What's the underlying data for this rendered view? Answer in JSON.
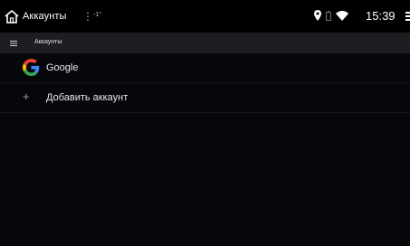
{
  "status_bar": {
    "title": "Аккаунты",
    "more_glyph": "⋮",
    "temperature": "-1°",
    "time": "15:39",
    "icons": [
      "location-pin-icon",
      "battery-icon",
      "wifi-icon",
      "usb-icon"
    ],
    "home_icon": "home-icon"
  },
  "app_bar": {
    "menu_icon": "hamburger-menu-icon",
    "title": "Аккаунты"
  },
  "accounts": [
    {
      "name": "Google",
      "icon": "google-logo"
    }
  ],
  "add_account": {
    "label": "Добавить аккаунт",
    "icon_glyph": "+"
  },
  "colors": {
    "background": "#05070a",
    "status_bar": "#000000",
    "app_bar": "#1c1e21",
    "google_blue": "#4285F4",
    "google_red": "#EA4335",
    "google_yellow": "#FBBC05",
    "google_green": "#34A853"
  }
}
